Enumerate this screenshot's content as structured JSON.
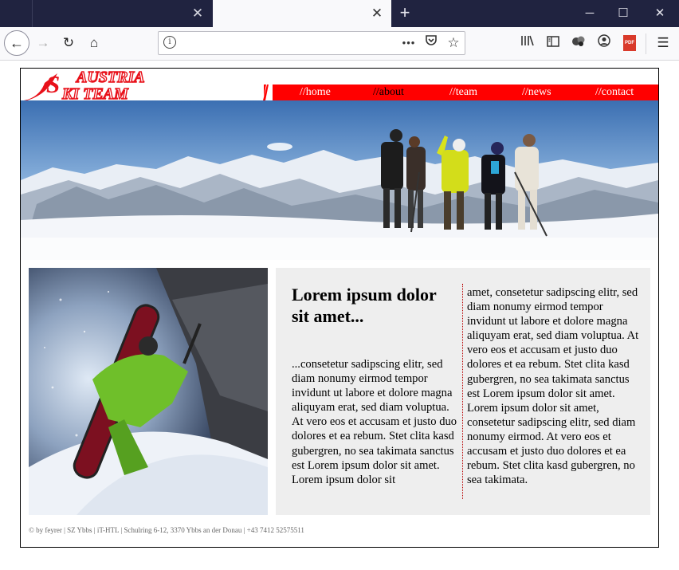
{
  "browser": {
    "url": "",
    "window_controls": {
      "minimize": "─",
      "maximize": "☐",
      "close": "✕"
    }
  },
  "site": {
    "logo": {
      "line1": "AUSTRIA",
      "line2": "KI TEAM",
      "initial": "S",
      "color": "#e8111a"
    },
    "menu": [
      {
        "label": "//home"
      },
      {
        "label": "//about"
      },
      {
        "label": "//team"
      },
      {
        "label": "//news"
      },
      {
        "label": "//contact"
      }
    ],
    "article": {
      "title": "Lorem ipsum dolor sit amet...",
      "col1": "...consetetur sadipscing elitr, sed diam nonumy eirmod tempor invidunt ut labore et dolore magna aliquyam erat, sed diam voluptua. At vero eos et accusam et justo duo dolores et ea rebum. Stet clita kasd gubergren, no sea takimata sanctus est Lorem ipsum dolor sit amet. Lorem ipsum dolor sit",
      "col2": "amet, consetetur sadipscing elitr, sed diam nonumy eirmod tempor invidunt ut labore et dolore magna aliquyam erat, sed diam voluptua. At vero eos et accusam et justo duo dolores et ea rebum. Stet clita kasd gubergren, no sea takimata sanctus est Lorem ipsum dolor sit amet. Lorem ipsum dolor sit amet, consetetur sadipscing elitr, sed diam nonumy eirmod. At vero eos et accusam et justo duo dolores et ea rebum. Stet clita kasd gubergren, no sea takimata."
    },
    "footer": "© by feyrer | SZ Ybbs | iT-HTL | Schulring 6-12, 3370 Ybbs an der Donau | +43 7412 52575511",
    "colors": {
      "accent": "#ff0000",
      "article_bg": "#eeeeee",
      "column_rule": "#b80000"
    }
  },
  "icons": {
    "toolbar": [
      "back-icon",
      "forward-icon",
      "reload-icon",
      "home-icon",
      "info-icon",
      "more-icon",
      "pocket-icon",
      "bookmark-star-icon",
      "library-icon",
      "sidebar-icon",
      "extension-icon",
      "account-icon",
      "pdf-icon",
      "menu-icon"
    ]
  }
}
